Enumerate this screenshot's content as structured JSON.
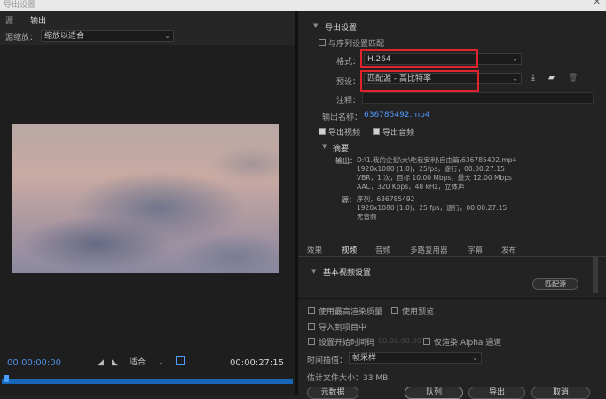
{
  "window": {
    "title": "导出设置",
    "close_icon": "close-icon"
  },
  "left": {
    "tabs": [
      "源",
      "输出"
    ],
    "source_scaling_label": "源缩放：",
    "source_scaling_value": "缩放以适合",
    "timecode_start": "00:00:00:00",
    "fit_value": "适合",
    "timecode_end": "00:00:27:15"
  },
  "right": {
    "section_title": "导出设置",
    "match_sequence_label": "与序列设置匹配",
    "format_label": "格式：",
    "format_value": "H.264",
    "preset_label": "预设：",
    "preset_value": "匹配源 - 高比特率",
    "comment_label": "注释：",
    "comment_value": "",
    "output_name_label": "输出名称：",
    "output_name_value": "636785492.mp4",
    "export_video_label": "导出视频",
    "export_audio_label": "导出音频",
    "summary": {
      "title": "摘要",
      "output_label": "输出：",
      "output_lines": [
        "D:\\1.我的企划\\大\\吃我安利\\自由篇\\636785492.mp4",
        "1920x1080 (1.0)，25fps，逐行，00:00:27:15",
        "VBR，1 次，目标 10.00 Mbps，最大 12.00 Mbps",
        "AAC，320 Kbps，48 kHz，立体声"
      ],
      "source_label": "源：",
      "source_lines": [
        "序列，636785492",
        "1920x1080 (1.0)，25 fps，逐行，00:00:27:15",
        "无音频"
      ]
    },
    "tabs": [
      "效果",
      "视频",
      "音频",
      "多路复用器",
      "字幕",
      "发布"
    ],
    "active_tab": "视频",
    "basic_video_settings": "基本视频设置",
    "match_source_button": "匹配源",
    "options": {
      "max_render_quality": "使用最高渲染质量",
      "use_previews": "使用预览",
      "import_into_project": "导入到项目中",
      "set_start_timecode": "设置开始时间码",
      "start_timecode_value": "00:00:00:00",
      "render_alpha_only": "仅渲染 Alpha 通道",
      "time_interpolation_label": "时间插值：",
      "time_interpolation_value": "帧采样",
      "estimated_file_size": "估计文件大小：33 MB"
    },
    "buttons": {
      "metadata": "元数据",
      "queue": "队列",
      "export": "导出",
      "cancel": "取消"
    }
  }
}
